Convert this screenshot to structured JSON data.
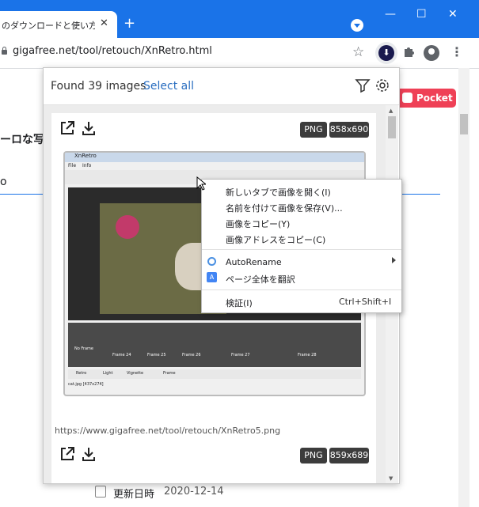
{
  "browser": {
    "tab_title": "のダウンロードと使い方 - k",
    "tab_close": "✕",
    "new_tab": "+",
    "url": "gigafree.net/tool/retouch/XnRetro.html",
    "win_minimize": "—",
    "win_maximize": "☐",
    "win_close": "✕",
    "accent": "#1a73e8"
  },
  "page": {
    "heading_fragment": "ーロな写真",
    "text_fragment": "o",
    "pocket_label": "Pocket",
    "date_label": "更新日時",
    "date_value": "2020-12-14"
  },
  "popup": {
    "found_text": "Found 39 images",
    "select_all": "Select all",
    "cards": [
      {
        "format": "PNG",
        "size": "858x690",
        "url": "https://www.gigafree.net/tool/retouch/XnRetro5.png"
      },
      {
        "format": "PNG",
        "size": "859x689"
      }
    ]
  },
  "context_menu": {
    "items": [
      {
        "label": "新しいタブで画像を開く(I)"
      },
      {
        "label": "名前を付けて画像を保存(V)..."
      },
      {
        "label": "画像をコピー(Y)"
      },
      {
        "label": "画像アドレスをコピー(C)"
      },
      {
        "label": "AutoRename",
        "icon": "autorename-icon"
      },
      {
        "label": "ページ全体を翻訳",
        "icon": "translate-icon"
      },
      {
        "label": "検証(I)",
        "shortcut": "Ctrl+Shift+I"
      }
    ]
  },
  "screenshot_app": {
    "title": "XnRetro",
    "menu": [
      "File",
      "Info"
    ],
    "filmstrip": [
      "No Frame",
      "Frame 24",
      "Frame 25",
      "Frame 26",
      "Frame 27",
      "Frame 28"
    ],
    "tabs": [
      "Retro",
      "Light",
      "Vignette",
      "Frame"
    ],
    "status": "cat.jpg [437x274]"
  }
}
